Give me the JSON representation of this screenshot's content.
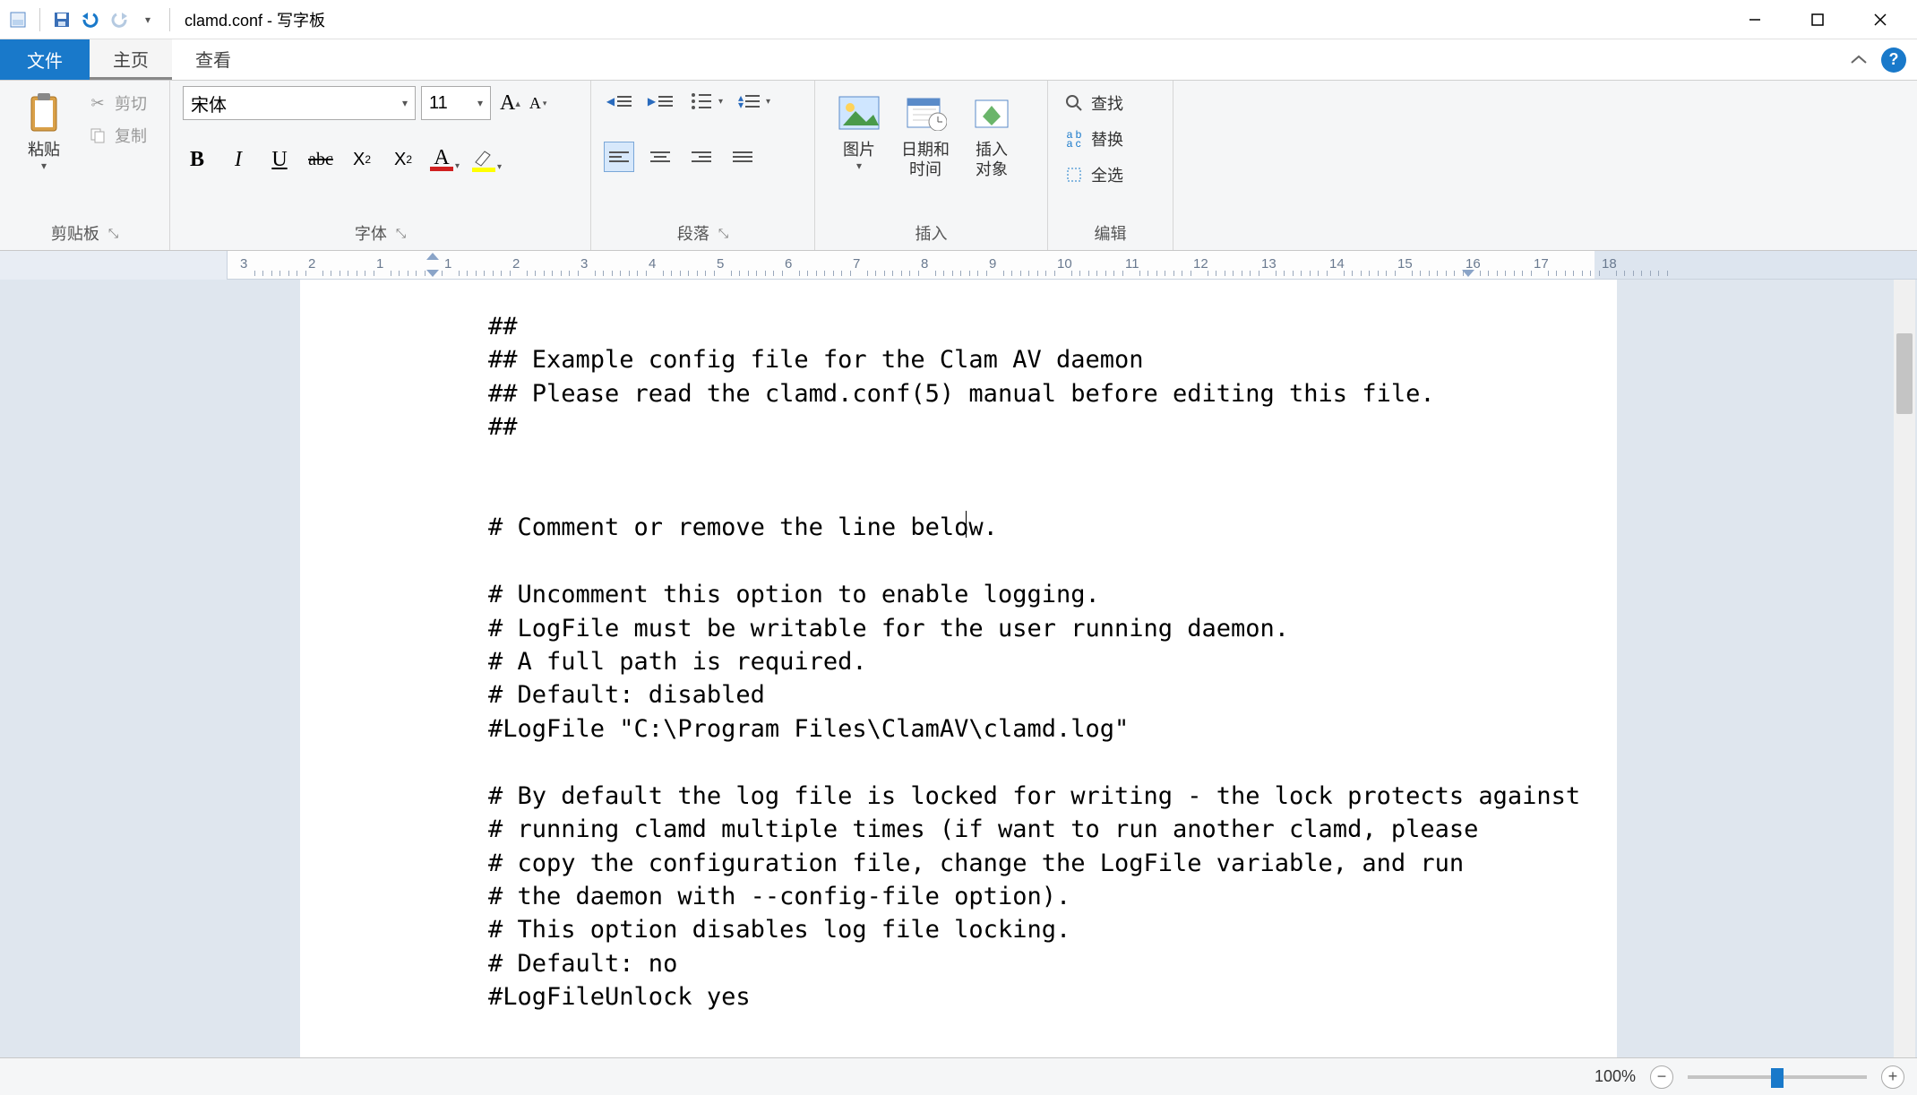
{
  "title": "clamd.conf - 写字板",
  "tabs": {
    "file": "文件",
    "home": "主页",
    "view": "查看"
  },
  "qat": {
    "save": "保存",
    "undo": "撤销",
    "redo": "重做"
  },
  "win": {
    "minimize": "最小化",
    "maximize": "最大化",
    "close": "关闭"
  },
  "clipboard_group": {
    "label": "剪贴板",
    "paste": "粘贴",
    "cut": "剪切",
    "copy": "复制"
  },
  "font_group": {
    "label": "字体",
    "font_name": "宋体",
    "font_size": "11",
    "grow": "A",
    "shrink": "A",
    "bold": "B",
    "italic": "I",
    "underline": "U",
    "strike": "abc",
    "subscript": "X",
    "superscript": "X",
    "text_color_letter": "A",
    "text_color": "#d02020",
    "highlight_color": "#ffff00"
  },
  "paragraph_group": {
    "label": "段落"
  },
  "insert_group": {
    "label": "插入",
    "picture": "图片",
    "datetime": "日期和\n时间",
    "object": "插入\n对象"
  },
  "edit_group": {
    "label": "编辑",
    "find": "查找",
    "replace": "替换",
    "select_all": "全选"
  },
  "ruler": {
    "numbers": [
      "3",
      "2",
      "1",
      "1",
      "2",
      "3",
      "4",
      "5",
      "6",
      "7",
      "8",
      "9",
      "10",
      "11",
      "12",
      "13",
      "14",
      "15",
      "16",
      "17",
      "18"
    ]
  },
  "document": {
    "lines": [
      "##",
      "## Example config file for the Clam AV daemon",
      "## Please read the clamd.conf(5) manual before editing this file.",
      "##",
      "",
      "",
      "# Comment or remove the line below.",
      "",
      "# Uncomment this option to enable logging.",
      "# LogFile must be writable for the user running daemon.",
      "# A full path is required.",
      "# Default: disabled",
      "#LogFile \"C:\\Program Files\\ClamAV\\clamd.log\"",
      "",
      "# By default the log file is locked for writing - the lock protects against",
      "# running clamd multiple times (if want to run another clamd, please",
      "# copy the configuration file, change the LogFile variable, and run",
      "# the daemon with --config-file option).",
      "# This option disables log file locking.",
      "# Default: no",
      "#LogFileUnlock yes"
    ],
    "cursor_line": 6,
    "cursor_col": 36
  },
  "statusbar": {
    "zoom": "100%"
  }
}
